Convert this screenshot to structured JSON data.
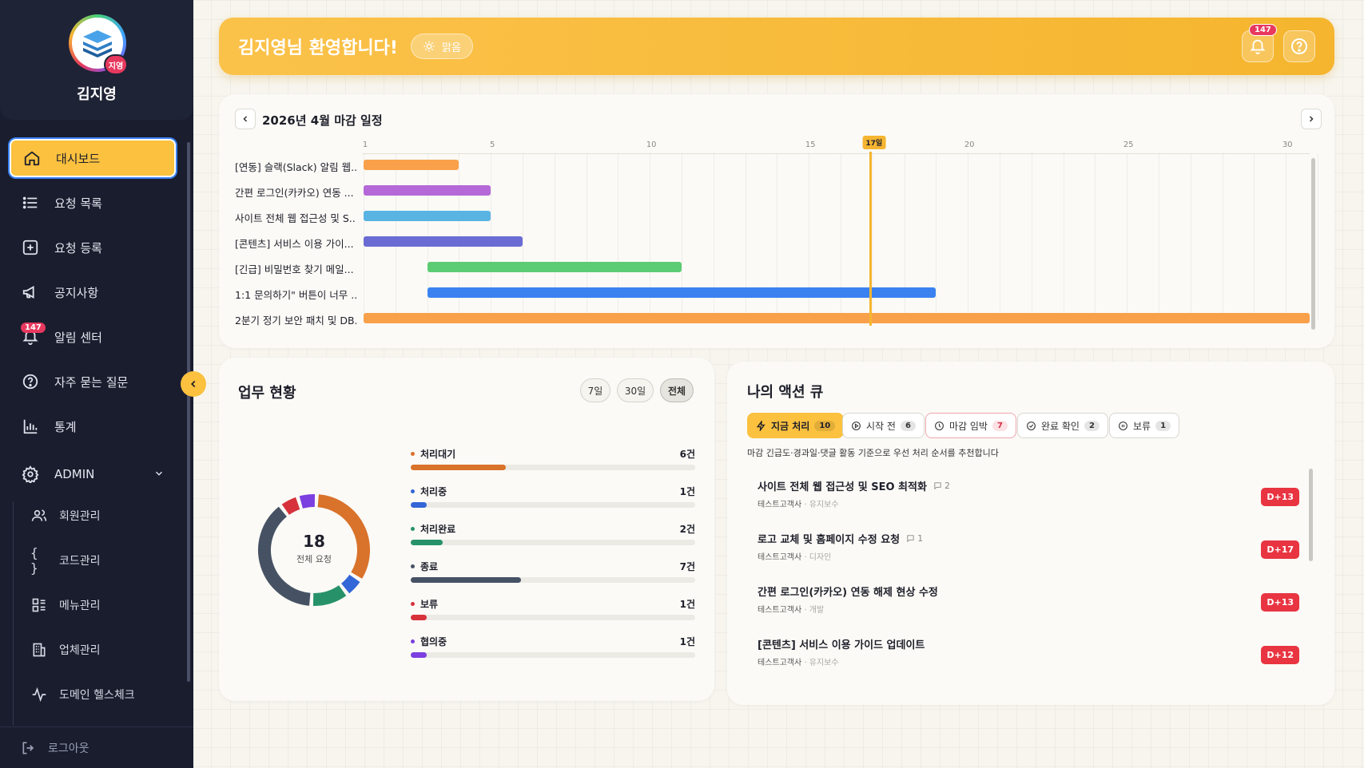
{
  "sidebar": {
    "user_name": "김지영",
    "avatar_badge": "지영",
    "nav": [
      {
        "label": "대시보드",
        "icon": "home-icon"
      },
      {
        "label": "요청 목록",
        "icon": "list-icon"
      },
      {
        "label": "요청 등록",
        "icon": "add-square-icon"
      },
      {
        "label": "공지사항",
        "icon": "megaphone-icon"
      },
      {
        "label": "알림 센터",
        "icon": "bell-icon",
        "badge": "147"
      },
      {
        "label": "자주 묻는 질문",
        "icon": "question-circle-icon"
      },
      {
        "label": "통계",
        "icon": "bar-chart-icon"
      },
      {
        "label": "ADMIN",
        "icon": "gear-icon"
      }
    ],
    "admin_items": [
      {
        "label": "회원관리",
        "icon": "users-icon"
      },
      {
        "label": "코드관리",
        "icon": "braces-icon"
      },
      {
        "label": "메뉴관리",
        "icon": "menu-grid-icon"
      },
      {
        "label": "업체관리",
        "icon": "building-icon"
      },
      {
        "label": "도메인 헬스체크",
        "icon": "pulse-icon"
      }
    ],
    "logout": "로그아웃"
  },
  "header": {
    "welcome": "김지영님 환영합니다!",
    "weather": "맑음",
    "notification_count": "147"
  },
  "gantt": {
    "title": "2026년 4월 마감 일정",
    "day_ticks": [
      "1",
      "5",
      "10",
      "15",
      "20",
      "25",
      "30"
    ],
    "today_label": "17일",
    "today": 17,
    "tasks": [
      {
        "label": "[연동] 슬랙(Slack) 알림 웹...",
        "start": 1,
        "end": 4,
        "color": "#f9a14a"
      },
      {
        "label": "간편 로그인(카카오) 연동 ...",
        "start": 1,
        "end": 5,
        "color": "#b568d8"
      },
      {
        "label": "사이트 전체 웹 접근성 및 S...",
        "start": 1,
        "end": 5,
        "color": "#5ab4e3"
      },
      {
        "label": "[콘텐츠] 서비스 이용 가이...",
        "start": 1,
        "end": 6,
        "color": "#6b6bd4"
      },
      {
        "label": "[긴급] 비밀번호 찾기 메일...",
        "start": 3,
        "end": 11,
        "color": "#5ccc74"
      },
      {
        "label": "1:1 문의하기\" 버튼이 너무 ...",
        "start": 3,
        "end": 19,
        "color": "#3b82f0"
      },
      {
        "label": "2분기 정기 보안 패치 및 DB...",
        "start": 1,
        "end": 31,
        "color": "#f9a14a"
      }
    ]
  },
  "status": {
    "title": "업무 현황",
    "periods": [
      "7일",
      "30일",
      "전체"
    ],
    "active_period": "전체",
    "total": "18",
    "total_caption": "전체 요청",
    "items": [
      {
        "label": "처리대기",
        "count": "6건",
        "value": 6,
        "color": "#d9722a"
      },
      {
        "label": "처리중",
        "count": "1건",
        "value": 1,
        "color": "#3366d6"
      },
      {
        "label": "처리완료",
        "count": "2건",
        "value": 2,
        "color": "#27926a"
      },
      {
        "label": "종료",
        "count": "7건",
        "value": 7,
        "color": "#465264"
      },
      {
        "label": "보류",
        "count": "1건",
        "value": 1,
        "color": "#d7323c"
      },
      {
        "label": "협의중",
        "count": "1건",
        "value": 1,
        "color": "#7c3fe0"
      }
    ]
  },
  "queue": {
    "title": "나의 액션 큐",
    "tabs": [
      {
        "label": "지금 처리",
        "count": "10",
        "icon": "bolt-icon"
      },
      {
        "label": "시작 전",
        "count": "6",
        "icon": "play-circle-icon"
      },
      {
        "label": "마감 임박",
        "count": "7",
        "icon": "clock-icon"
      },
      {
        "label": "완료 확인",
        "count": "2",
        "icon": "check-circle-icon"
      },
      {
        "label": "보류",
        "count": "1",
        "icon": "pause-circle-icon"
      }
    ],
    "hint": "마감 긴급도·경과일·댓글 활동 기준으로 우선 처리 순서를 추천합니다",
    "items": [
      {
        "title": "사이트 전체 웹 접근성 및 SEO 최적화",
        "comments": "2",
        "company": "테스트고객사",
        "category": "유지보수",
        "dday": "D+13"
      },
      {
        "title": "로고 교체 및 홈페이지 수정 요청",
        "comments": "1",
        "company": "테스트고객사",
        "category": "디자인",
        "dday": "D+17"
      },
      {
        "title": "간편 로그인(카카오) 연동 해제 현상 수정",
        "comments": "",
        "company": "테스트고객사",
        "category": "개발",
        "dday": "D+13"
      },
      {
        "title": "[콘텐츠] 서비스 이용 가이드 업데이트",
        "comments": "",
        "company": "테스트고객사",
        "category": "유지보수",
        "dday": "D+12"
      }
    ]
  }
}
